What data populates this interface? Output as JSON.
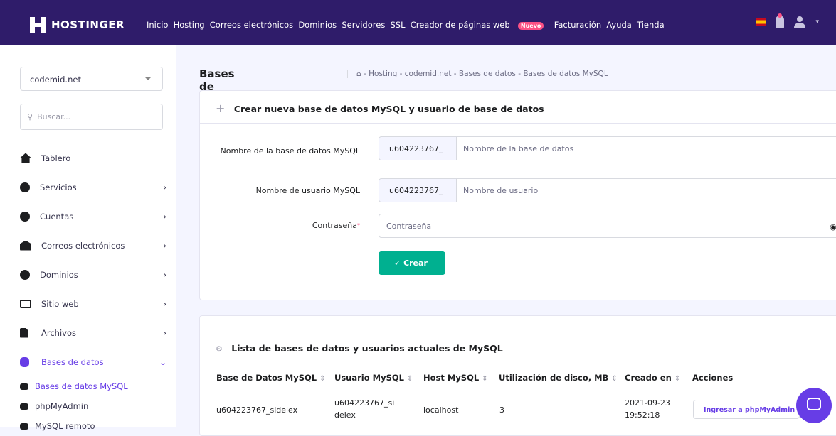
{
  "topbar": {
    "brand": "HOSTINGER",
    "nav": [
      "Inicio",
      "Hosting",
      "Correos electrónicos",
      "Dominios",
      "Servidores",
      "SSL",
      "Creador de páginas web",
      "Facturación",
      "Ayuda",
      "Tienda"
    ],
    "badge": "Nuevo",
    "bg_color": "#2f1c6a"
  },
  "sidebar": {
    "domain_select": "codemid.net",
    "search_placeholder": "Buscar...",
    "items": [
      {
        "label": "Tablero",
        "icon": "home-icon"
      },
      {
        "label": "Servicios",
        "icon": "info-icon"
      },
      {
        "label": "Cuentas",
        "icon": "info-icon"
      },
      {
        "label": "Correos electrónicos",
        "icon": "envelope-icon"
      },
      {
        "label": "Dominios",
        "icon": "globe-icon"
      },
      {
        "label": "Sitio web",
        "icon": "monitor-icon"
      },
      {
        "label": "Archivos",
        "icon": "file-icon"
      },
      {
        "label": "Bases de datos",
        "icon": "database-icon"
      }
    ],
    "subitems": [
      "Bases de datos MySQL",
      "phpMyAdmin",
      "MySQL remoto"
    ]
  },
  "main": {
    "title": "Bases de datos MySQL",
    "breadcrumb": "- Hosting - codemid.net - Bases de datos - Bases de datos MySQL",
    "create_card": {
      "title": "Crear nueva base de datos MySQL y usuario de base de datos",
      "db_label": "Nombre de la base de datos MySQL",
      "db_prefix": "u604223767_",
      "db_placeholder": "Nombre de la base de datos",
      "user_label": "Nombre de usuario MySQL",
      "user_prefix": "u604223767_",
      "user_placeholder": "Nombre de usuario",
      "pass_label": "Contraseña",
      "pass_placeholder": "Contraseña",
      "submit": "Crear",
      "accent_color": "#00b090"
    },
    "list_card": {
      "title": "Lista de bases de datos y usuarios actuales de MySQL",
      "headers": [
        "Base de Datos MySQL",
        "Usuario MySQL",
        "Host MySQL",
        "Utilización de disco, MB",
        "Creado en",
        "Acciones"
      ],
      "row": {
        "db": "u604223767_sidelex",
        "user": "u604223767_sidelex",
        "host": "localhost",
        "disk": "3",
        "created": "2021-09-23 19:52:18",
        "action": "Ingresar a phpMyAdmin"
      }
    }
  }
}
